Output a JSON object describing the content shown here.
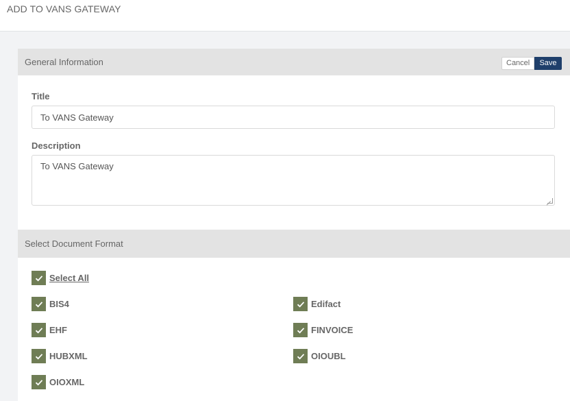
{
  "page": {
    "title": "ADD TO VANS GATEWAY"
  },
  "general": {
    "header": "General Information",
    "cancel_label": "Cancel",
    "save_label": "Save",
    "title_label": "Title",
    "title_value": "To VANS Gateway",
    "description_label": "Description",
    "description_value": "To VANS Gateway"
  },
  "formats": {
    "header": "Select Document Format",
    "select_all": {
      "label": "Select All",
      "checked": true
    },
    "items": [
      {
        "label": "BIS4",
        "checked": true
      },
      {
        "label": "Edifact",
        "checked": true
      },
      {
        "label": "EHF",
        "checked": true
      },
      {
        "label": "FINVOICE",
        "checked": true
      },
      {
        "label": "HUBXML",
        "checked": true
      },
      {
        "label": "OIOUBL",
        "checked": true
      },
      {
        "label": "OIOXML",
        "checked": true
      }
    ]
  },
  "colors": {
    "checkbox": "#6f7d55",
    "save_button": "#1f3f6b",
    "section_header": "#e3e3e3"
  }
}
